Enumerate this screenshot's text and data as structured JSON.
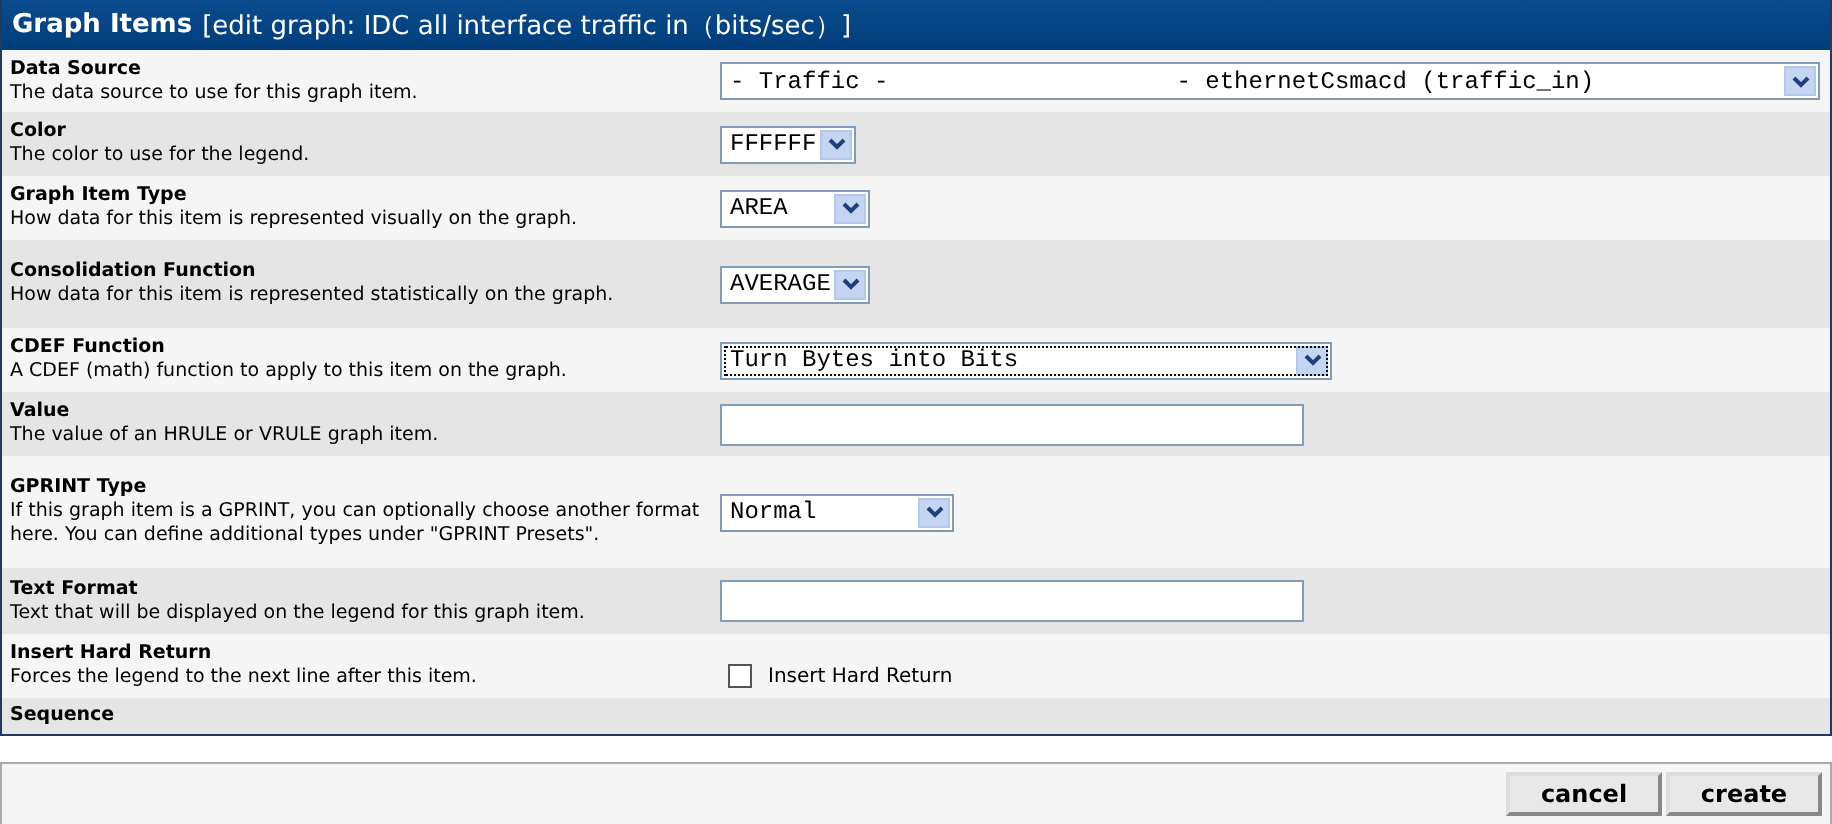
{
  "panel": {
    "title": "Graph Items",
    "subtitle": "[edit graph: IDC all interface traffic in（bits/sec）]"
  },
  "fields": [
    {
      "kind": "select",
      "label": "Data Source",
      "description": "The data source to use for this graph item.",
      "value": "- Traffic -                    - ethernetCsmacd (traffic_in)"
    },
    {
      "kind": "select",
      "label": "Color",
      "description": "The color to use for the legend.",
      "value": "FFFFFF"
    },
    {
      "kind": "select",
      "label": "Graph Item Type",
      "description": "How data for this item is represented visually on the graph.",
      "value": "AREA"
    },
    {
      "kind": "select",
      "label": "Consolidation Function",
      "description": "How data for this item is represented statistically on the graph.",
      "value": "AVERAGE"
    },
    {
      "kind": "select",
      "label": "CDEF Function",
      "description": "A CDEF (math) function to apply to this item on the graph.",
      "value": "Turn Bytes into Bits",
      "focused": true
    },
    {
      "kind": "input",
      "label": "Value",
      "description": "The value of an HRULE or VRULE graph item."
    },
    {
      "kind": "select",
      "label": "GPRINT Type",
      "description": "If this graph item is a GPRINT, you can optionally choose another format here. You can define additional types under \"GPRINT Presets\".",
      "value": "Normal"
    },
    {
      "kind": "input",
      "label": "Text Format",
      "description": "Text that will be displayed on the legend for this graph item."
    },
    {
      "kind": "checkbox",
      "label": "Insert Hard Return",
      "description": "Forces the legend to the next line after this item.",
      "option": "Insert Hard Return",
      "checked": false
    },
    {
      "kind": "none",
      "label": "Sequence"
    }
  ],
  "buttons": [
    "cancel",
    "create"
  ]
}
